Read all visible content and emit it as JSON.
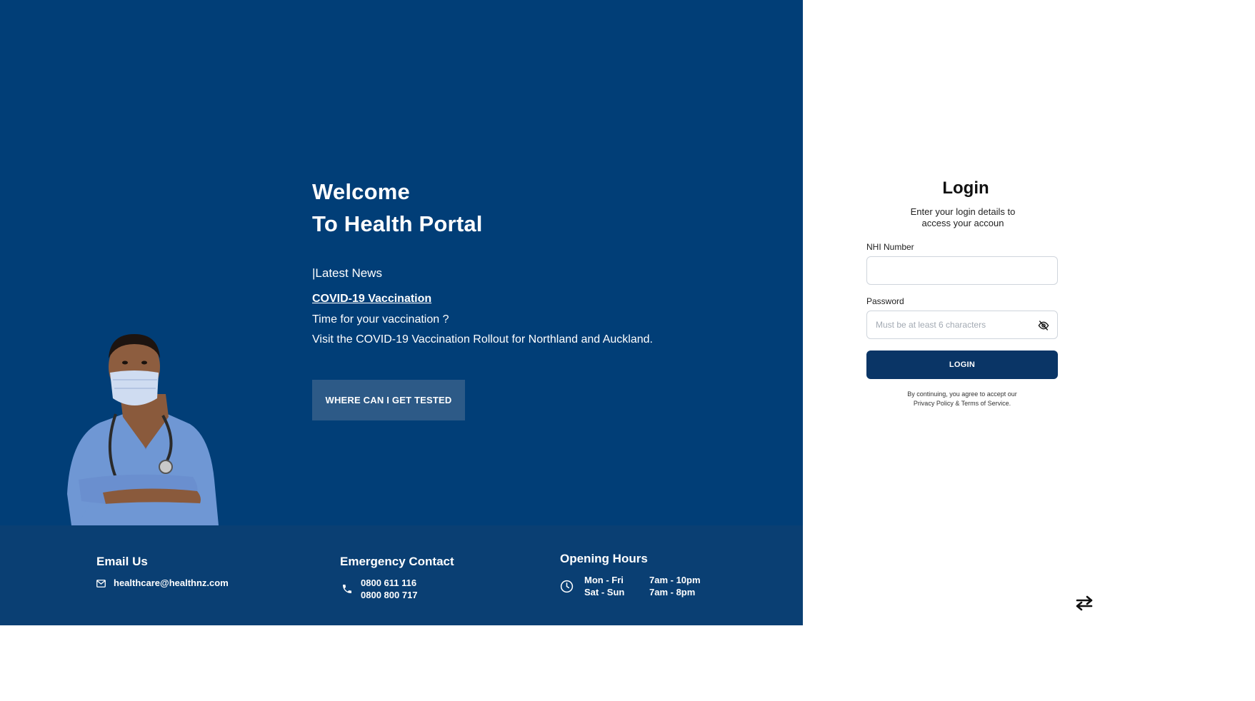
{
  "hero": {
    "welcome_line1": "Welcome",
    "welcome_line2": "To Health Portal",
    "latest_news_heading": "|Latest News",
    "news_link": "COVID-19 Vaccination",
    "news_line1": "Time for your vaccination ?",
    "news_line2": "Visit the COVID-19 Vaccination Rollout for Northland and Auckland.",
    "test_button": "WHERE CAN I GET TESTED"
  },
  "footer": {
    "email": {
      "title": "Email Us",
      "value": "healthcare@healthnz.com"
    },
    "emergency": {
      "title": "Emergency Contact",
      "phone1": "0800 611 116",
      "phone2": "0800 800 717"
    },
    "hours": {
      "title": "Opening Hours",
      "day1": "Mon - Fri",
      "time1": "7am - 10pm",
      "day2": "Sat - Sun",
      "time2": "7am - 8pm"
    }
  },
  "login": {
    "title": "Login",
    "subtitle_line1": "Enter your login details to",
    "subtitle_line2": "access your accoun",
    "nhi_label": "NHI Number",
    "nhi_value": "",
    "password_label": "Password",
    "password_placeholder": "Must be at least 6 characters",
    "button": "LOGIN",
    "terms_line1": "By continuing, you agree to accept our",
    "terms_line2": "Privacy Policy & Terms of Service."
  },
  "icons": {
    "mail": "mail-icon",
    "phone": "phone-icon",
    "clock": "clock-icon",
    "eye": "eye-off-icon",
    "swap": "swap-arrows-icon"
  },
  "colors": {
    "hero_bg": "#013e77",
    "footer_bg": "#0a3f73",
    "test_button_bg": "#2d5a87",
    "login_button_bg": "#0a3566"
  }
}
